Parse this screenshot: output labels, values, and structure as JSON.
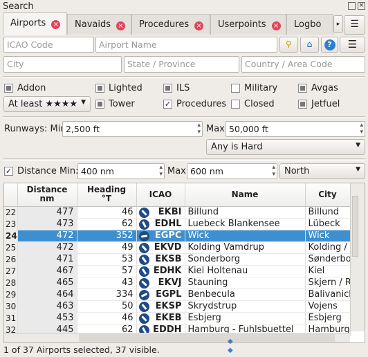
{
  "window": {
    "title": "Search"
  },
  "tabs": [
    {
      "label": "Airports",
      "active": true
    },
    {
      "label": "Navaids"
    },
    {
      "label": "Procedures"
    },
    {
      "label": "Userpoints"
    },
    {
      "label": "Logbo"
    }
  ],
  "filters": {
    "icao_placeholder": "ICAO Code",
    "name_placeholder": "Airport Name",
    "city_placeholder": "City",
    "state_placeholder": "State / Province",
    "country_placeholder": "Country / Area Code",
    "checkboxes": [
      {
        "label": "Addon",
        "state": "partial"
      },
      {
        "label": "Lighted",
        "state": "partial"
      },
      {
        "label": "ILS",
        "state": "partial"
      },
      {
        "label": "Military",
        "state": "unchecked"
      },
      {
        "label": "Avgas",
        "state": "partial"
      },
      {
        "label": "Tower",
        "state": "partial"
      },
      {
        "label": "Procedures",
        "state": "checked"
      },
      {
        "label": "Closed",
        "state": "unchecked"
      },
      {
        "label": "Jetfuel",
        "state": "partial"
      }
    ],
    "rating_combo": "At least ★★★★",
    "runways_label": "Runways: Min:",
    "runways_min": "2,500 ft",
    "runways_max_label": "Max:",
    "runways_max": "50,000 ft",
    "surface_combo": "Any is Hard",
    "distance_label": "Distance",
    "distance_checked": true,
    "dist_min_label": "Min:",
    "dist_min": "400 nm",
    "dist_max_label": "Max:",
    "dist_max": "600 nm",
    "direction_combo": "North"
  },
  "table": {
    "columns": [
      "",
      "Distance\nnm",
      "Heading\n°T",
      "ICAO",
      "Name",
      "City"
    ],
    "rows": [
      [
        "22",
        "477",
        "46",
        "EKBI",
        "Billund",
        "Billund"
      ],
      [
        "23",
        "473",
        "62",
        "EDHL",
        "Luebeck Blankensee",
        "Lübeck"
      ],
      [
        "24",
        "472",
        "352",
        "EGPC",
        "Wick",
        "Wick"
      ],
      [
        "25",
        "472",
        "49",
        "EKVD",
        "Kolding Vamdrup",
        "Kolding / Va"
      ],
      [
        "26",
        "471",
        "53",
        "EKSB",
        "Sonderborg",
        "Sønderborg"
      ],
      [
        "27",
        "467",
        "57",
        "EDHK",
        "Kiel Holtenau",
        "Kiel"
      ],
      [
        "28",
        "465",
        "43",
        "EKVJ",
        "Stauning",
        "Skjern / Rin"
      ],
      [
        "29",
        "464",
        "334",
        "EGPL",
        "Benbecula",
        "Balivanich"
      ],
      [
        "30",
        "463",
        "50",
        "EKSP",
        "Skrydstrup",
        "Vojens"
      ],
      [
        "31",
        "453",
        "46",
        "EKEB",
        "Esbjerg",
        "Esbjerg"
      ],
      [
        "32",
        "445",
        "62",
        "EDDH",
        "Hamburg - Fuhlsbuettel",
        "Hamburg"
      ]
    ],
    "selected_row": "24"
  },
  "status": "1 of 37 Airports selected, 37 visible."
}
